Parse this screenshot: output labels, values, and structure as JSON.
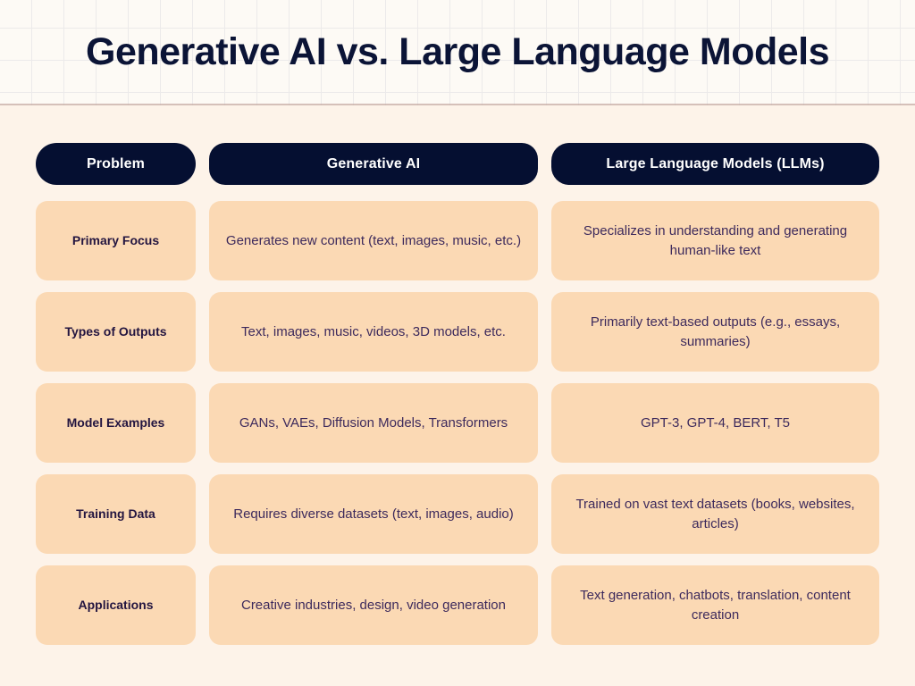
{
  "header": {
    "title": "Generative AI vs. Large Language Models"
  },
  "theme": {
    "header_background": "#fdfaf5",
    "grid_line": "#eceaea",
    "divider": "#c7aca4",
    "body_background": "#fdf3e9",
    "header_pill": "#050f31",
    "header_pill_text": "#ffffff",
    "cell_background": "#fbd9b4",
    "label_text": "#231540",
    "value_text": "#3d2a5c",
    "title_text": "#0b1436"
  },
  "table": {
    "columns": [
      "Problem",
      "Generative AI",
      "Large Language Models (LLMs)"
    ],
    "rows": [
      {
        "label": "Primary Focus",
        "generative_ai": "Generates new content (text, images, music, etc.)",
        "llm": "Specializes in understanding and generating human-like text"
      },
      {
        "label": "Types of Outputs",
        "generative_ai": "Text, images, music, videos, 3D models, etc.",
        "llm": "Primarily text-based outputs (e.g., essays, summaries)"
      },
      {
        "label": "Model Examples",
        "generative_ai": "GANs, VAEs, Diffusion Models, Transformers",
        "llm": "GPT-3, GPT-4, BERT, T5"
      },
      {
        "label": "Training Data",
        "generative_ai": "Requires diverse datasets (text, images, audio)",
        "llm": "Trained on vast text datasets (books, websites, articles)"
      },
      {
        "label": "Applications",
        "generative_ai": "Creative industries, design, video generation",
        "llm": "Text generation, chatbots, translation, content creation"
      }
    ]
  }
}
